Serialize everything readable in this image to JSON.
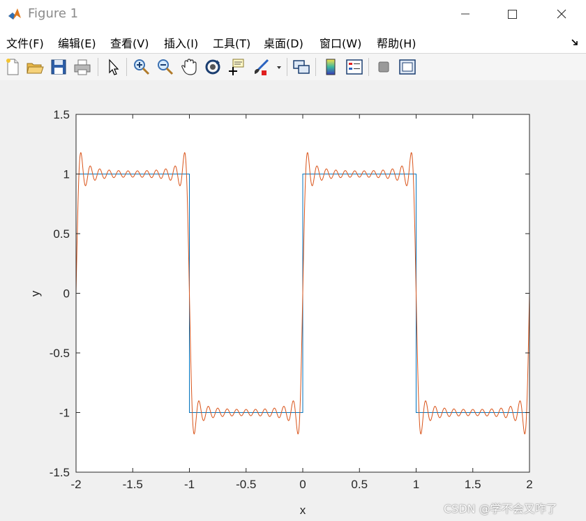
{
  "window": {
    "title": "Figure 1"
  },
  "menu": {
    "items": [
      {
        "label": "文件(F)"
      },
      {
        "label": "编辑(E)"
      },
      {
        "label": "查看(V)"
      },
      {
        "label": "插入(I)"
      },
      {
        "label": "工具(T)"
      },
      {
        "label": "桌面(D)"
      },
      {
        "label": "窗口(W)"
      },
      {
        "label": "帮助(H)"
      }
    ]
  },
  "toolbar": {
    "icons": [
      "new-figure-icon",
      "open-file-icon",
      "save-icon",
      "print-icon",
      "select-arrow-icon",
      "zoom-in-icon",
      "zoom-out-icon",
      "pan-hand-icon",
      "rotate-3d-icon",
      "data-cursor-icon",
      "brush-icon",
      "dropdown-arrow-icon",
      "link-plot-icon",
      "colorbar-icon",
      "legend-icon",
      "hide-plot-tools-icon",
      "show-plot-tools-icon"
    ]
  },
  "watermark": "CSDN @学不会又咋了",
  "chart_data": {
    "type": "line",
    "xlabel": "x",
    "ylabel": "y",
    "xlim": [
      -2,
      2
    ],
    "ylim": [
      -1.5,
      1.5
    ],
    "xticks": [
      "-2",
      "-1.5",
      "-1",
      "-0.5",
      "0",
      "0.5",
      "1",
      "1.5",
      "2"
    ],
    "yticks": [
      "-1.5",
      "-1",
      "-0.5",
      "0",
      "0.5",
      "1",
      "1.5"
    ],
    "grid": false,
    "colors": {
      "square_wave": "#0072bd",
      "fourier_approx": "#d95319"
    },
    "series": [
      {
        "kind": "square_wave",
        "x": [
          -2,
          -1,
          -1,
          0,
          0,
          1,
          1,
          2
        ],
        "y": [
          1,
          1,
          -1,
          -1,
          1,
          1,
          -1,
          -1
        ]
      },
      {
        "kind": "fourier_partial_sum",
        "harmonics": 12,
        "x_range": [
          -2,
          2
        ]
      }
    ]
  }
}
